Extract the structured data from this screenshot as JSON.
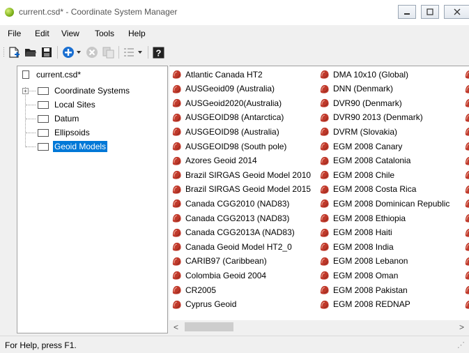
{
  "window": {
    "title": "current.csd* - Coordinate System Manager",
    "minimize_symbol": "▭",
    "maximize_symbol": "▢",
    "close_symbol": "✕"
  },
  "menu": [
    "File",
    "Edit",
    "View",
    "Tools",
    "Help"
  ],
  "toolbar": {
    "icons": [
      "new-file-icon",
      "open-folder-icon",
      "save-icon",
      "add-icon",
      "dropdown-arrow-icon",
      "delete-icon",
      "copy-icon",
      "properties-icon",
      "dropdown-arrow-icon",
      "help-icon"
    ]
  },
  "tree": {
    "root": "current.csd*",
    "items": [
      "Coordinate Systems",
      "Local Sites",
      "Datum",
      "Ellipsoids",
      "Geoid Models"
    ],
    "selected_index": 4,
    "expander": "+"
  },
  "geoid_columns": [
    [
      "Atlantic Canada HT2",
      "AUSGeoid09 (Australia)",
      "AUSGeoid2020(Australia)",
      "AUSGEOID98 (Antarctica)",
      "AUSGEOID98 (Australia)",
      "AUSGEOID98 (South pole)",
      "Azores Geoid 2014",
      "Brazil SIRGAS Geoid Model 2010",
      "Brazil SIRGAS Geoid Model 2015",
      "Canada CGG2010 (NAD83)",
      "Canada CGG2013 (NAD83)",
      "Canada CGG2013A (NAD83)",
      "Canada Geoid Model HT2_0",
      "CARIB97 (Caribbean)",
      "Colombia Geoid 2004",
      "CR2005",
      "Cyprus Geoid"
    ],
    [
      "DMA 10x10 (Global)",
      "DNN (Denmark)",
      "DVR90 (Denmark)",
      "DVR90 2013 (Denmark)",
      "DVRM (Slovakia)",
      "EGM 2008 Canary",
      "EGM 2008 Catalonia",
      "EGM 2008 Chile",
      "EGM 2008 Costa Rica",
      "EGM 2008 Dominican Republic",
      "EGM 2008 Ethiopia",
      "EGM 2008 Haiti",
      "EGM 2008 India",
      "EGM 2008 Lebanon",
      "EGM 2008 Oman",
      "EGM 2008 Pakistan",
      "EGM 2008 REDNAP"
    ]
  ],
  "scroll": {
    "left_arrow": "<",
    "right_arrow": ">"
  },
  "status": {
    "text": "For Help, press F1.",
    "grip": "⋰"
  },
  "colors": {
    "accent": "#0078d7",
    "geoid_icon": "#c0392b"
  }
}
